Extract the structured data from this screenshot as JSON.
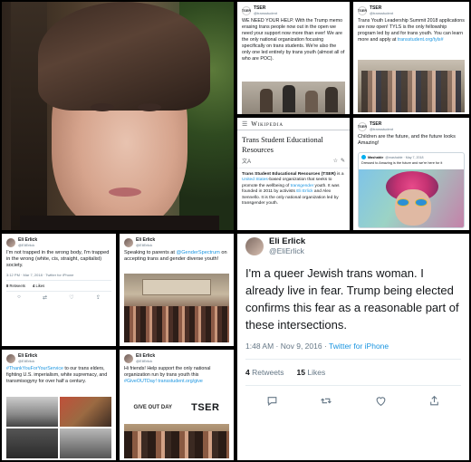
{
  "portrait": {
    "alt": ""
  },
  "tweet1": {
    "brand": "TSER",
    "handle": "@transstudent",
    "text": "WE NEED YOUR HELP. With the Trump memo erasing trans people now out in the open we need your support now more than ever! We are the only national organization focusing specifically on trans students. We're also the only one led entirely by trans youth (almost all of who are POC)."
  },
  "tweet2": {
    "brand": "TSER",
    "handle": "@transstudent",
    "text": "Trans Youth Leadership Summit 2018 applications are now open! TYLS is the only fellowship program led by and for trans youth. You can learn more and apply at ",
    "link": "transstudent.org/tyls#"
  },
  "wiki": {
    "logo": "Wikipedia",
    "title": "Trans Student Educational Resources",
    "body_bold": "Trans Student Educational Resources (TSER)",
    "body_1": " is a ",
    "link1": "United States",
    "body_2": "-based organization that seeks to promote the wellbeing of ",
    "link2": "transgender",
    "body_3": " youth. It was founded in 2011 by activists ",
    "link3": "Eli Erlick",
    "body_4": " and Alex Sennello. It is the only national organization led by transgender youth."
  },
  "tweet3": {
    "brand": "TSER",
    "handle": "@transstudent",
    "text": "Children are the future, and the future looks Amazing!",
    "quote_name": "Mashable",
    "quote_handle": "@mashable · May 7, 2018",
    "quote_text": "Dressed to Amazing is the future and we're here for it"
  },
  "tweet4": {
    "name": "Eli Erlick",
    "handle": "@EliErlick",
    "text": "I'm not trapped in the wrong body, I'm trapped in the wrong (white, cis, straight, capitalist) society.",
    "meta": "3:12 PM · Mar 7, 2018 · Twitter for iPhone",
    "retweets": "Retweets",
    "likes": "Likes"
  },
  "tweet5": {
    "name": "Eli Erlick",
    "handle": "@EliErlick",
    "text_1": "Speaking to parents at ",
    "mention": "@GenderSpectrum",
    "text_2": " on accepting trans and gender diverse youth!"
  },
  "tweet6": {
    "name": "Eli Erlick",
    "handle": "@EliErlick",
    "text": "I'm a queer Jewish trans woman. I already live in fear. Trump being elected confirms this fear as a reasonable part of these intersections.",
    "time": "1:48 AM · Nov 9, 2016 · ",
    "via": "Twitter for iPhone",
    "retweets_count": "4",
    "retweets_label": " Retweets",
    "likes_count": "15",
    "likes_label": " Likes"
  },
  "tweet7": {
    "name": "Eli Erlick",
    "handle": "@EliErlick",
    "hashtag": "#ThankYouForYourService",
    "text": " to our trans elders, fighting U.S. imperialism, white supremacy, and transmisogyny for over half a century."
  },
  "tweet8": {
    "name": "Eli Erlick",
    "handle": "@EliErlick",
    "text_1": "Hi friends! Help support the only national organization run by trans youth this ",
    "hashtag": "#GiveOUTDay!",
    "link": " transstudent.org/give",
    "logo_1": "GIVE OUT DAY",
    "logo_2": "TSER"
  },
  "colors": {
    "link": "#1b95e0",
    "muted": "#657786",
    "text": "#14171a"
  }
}
